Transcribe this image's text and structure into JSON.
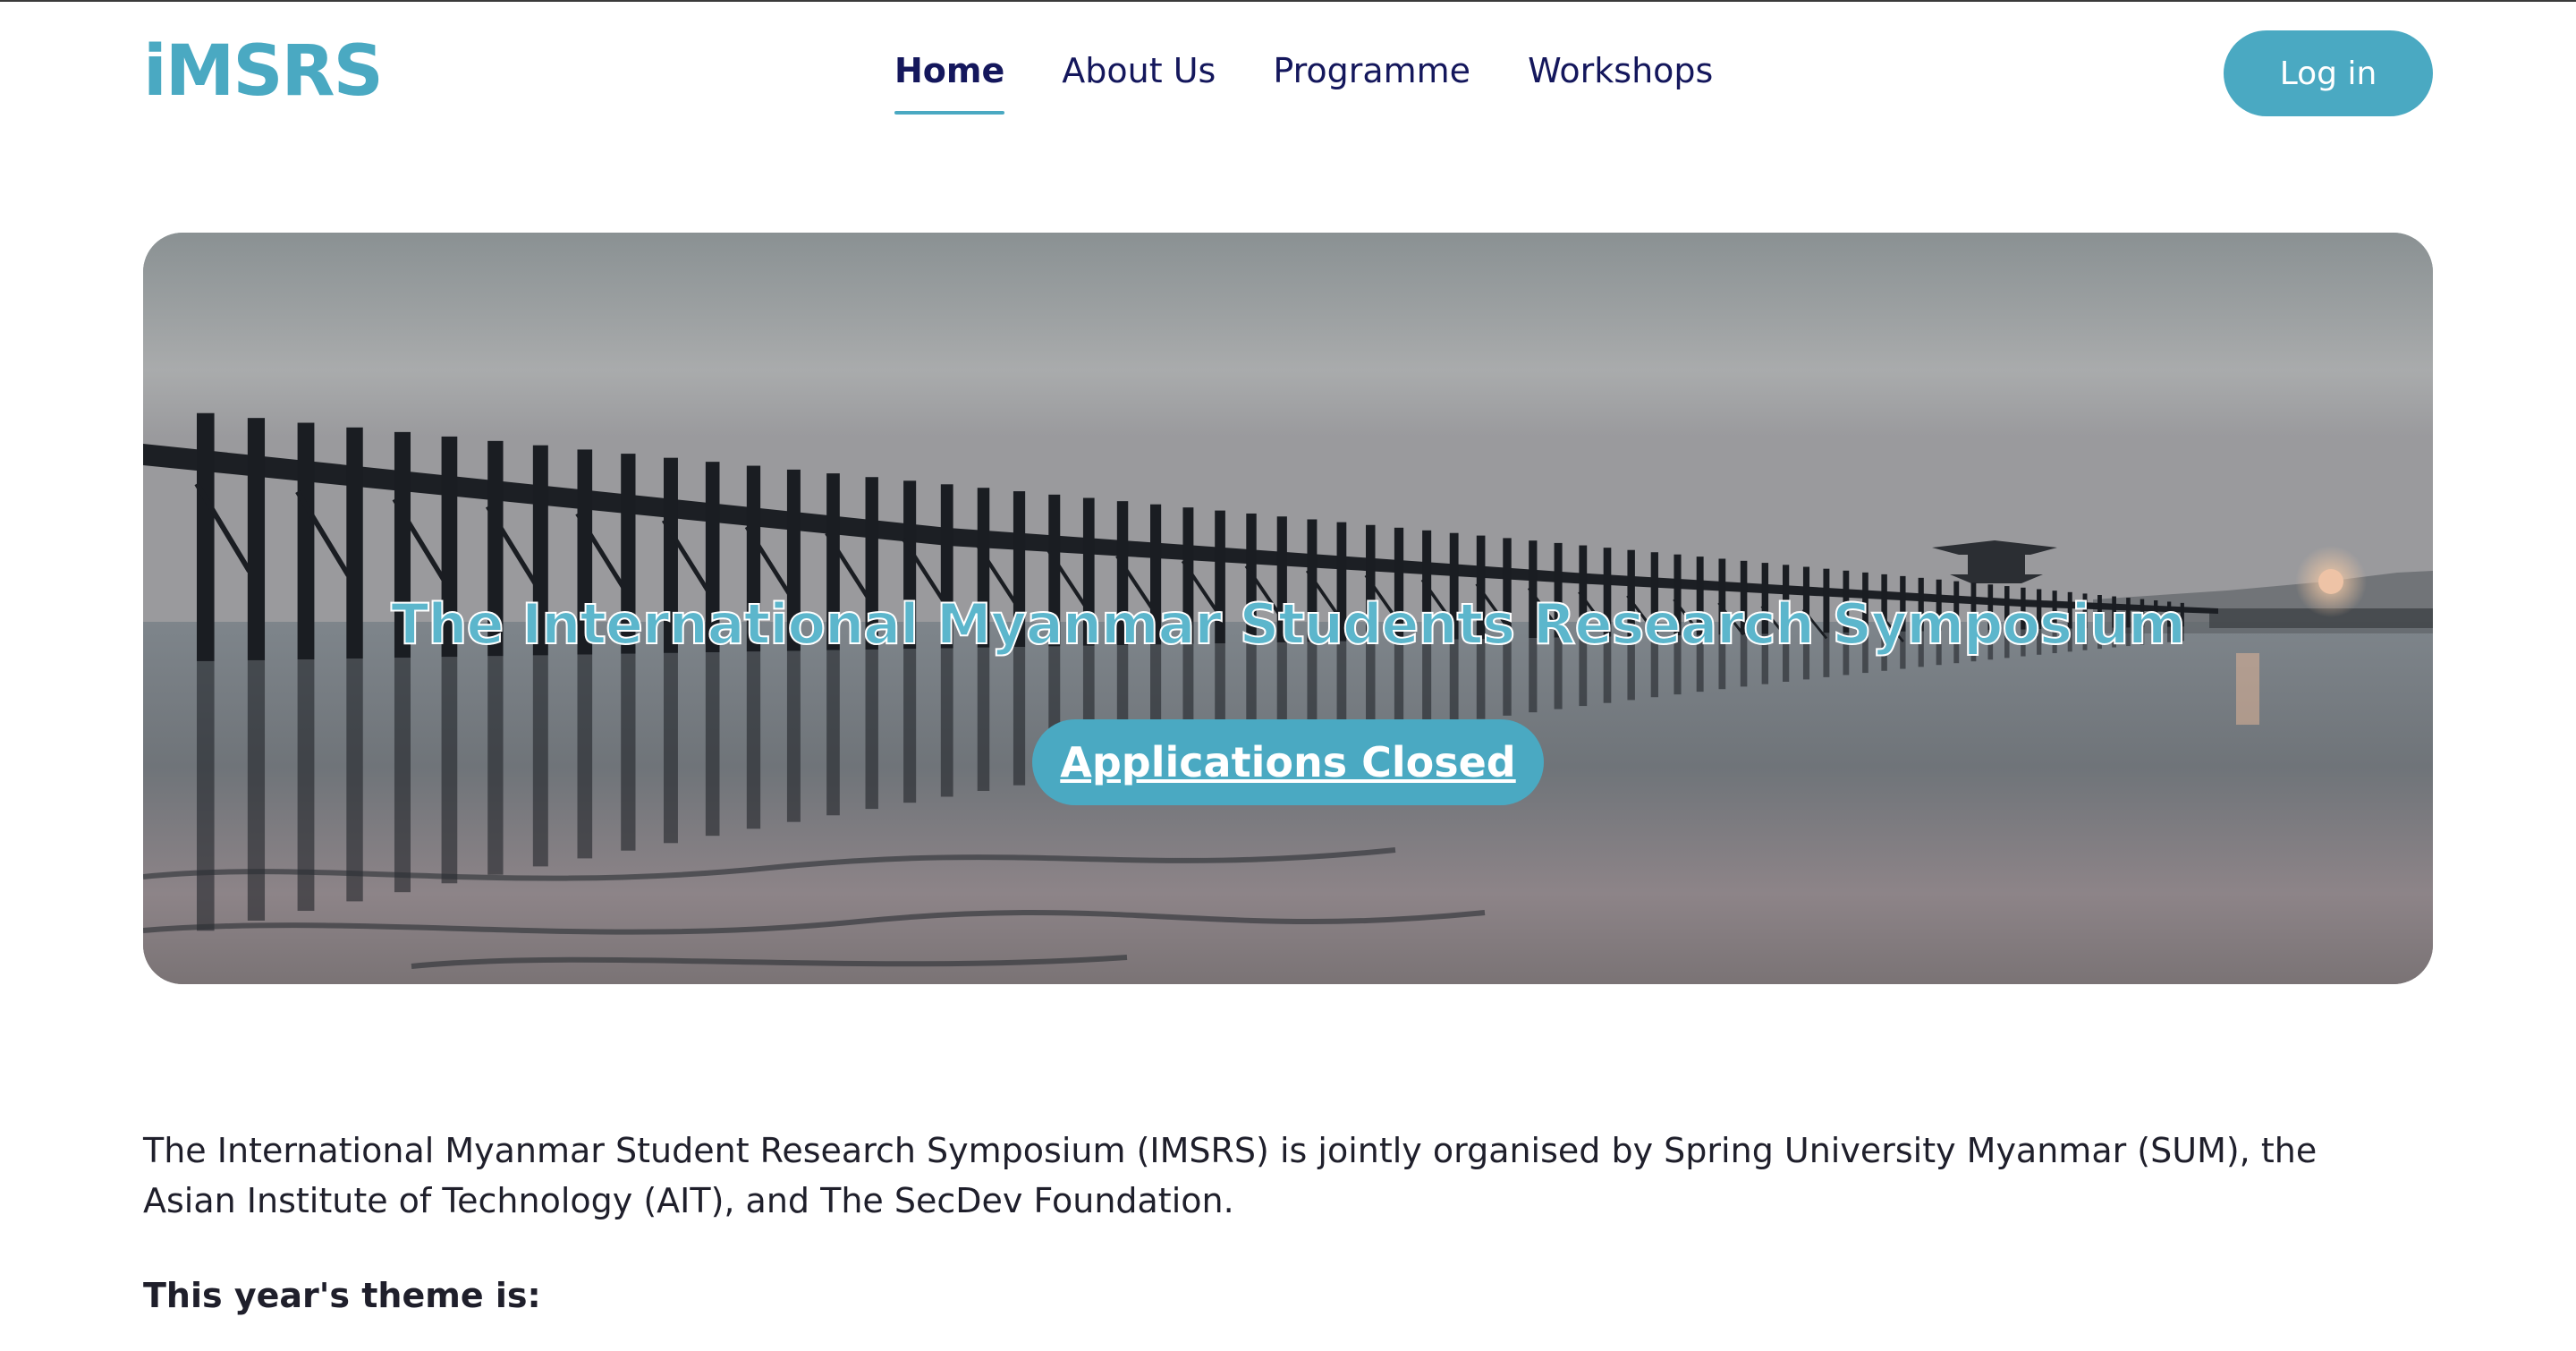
{
  "header": {
    "logo_text": "iMSRS",
    "nav": [
      {
        "label": "Home",
        "active": true
      },
      {
        "label": "About Us",
        "active": false
      },
      {
        "label": "Programme",
        "active": false
      },
      {
        "label": "Workshops",
        "active": false
      }
    ],
    "login_label": "Log in"
  },
  "hero": {
    "title": "The International Myanmar Students Research Symposium",
    "button_label": "Applications Closed",
    "image_description_icon": "bridge-over-lake-photo"
  },
  "content": {
    "intro": "The International Myanmar Student Research Symposium (IMSRS) is jointly organised by Spring University Myanmar (SUM), the Asian Institute of Technology (AIT), and The SecDev Foundation.",
    "theme_label": "This year's theme is:"
  },
  "colors": {
    "accent": "#4aa9c2",
    "navy": "#14175c",
    "text": "#1f1f2b",
    "background": "#ffffff"
  }
}
